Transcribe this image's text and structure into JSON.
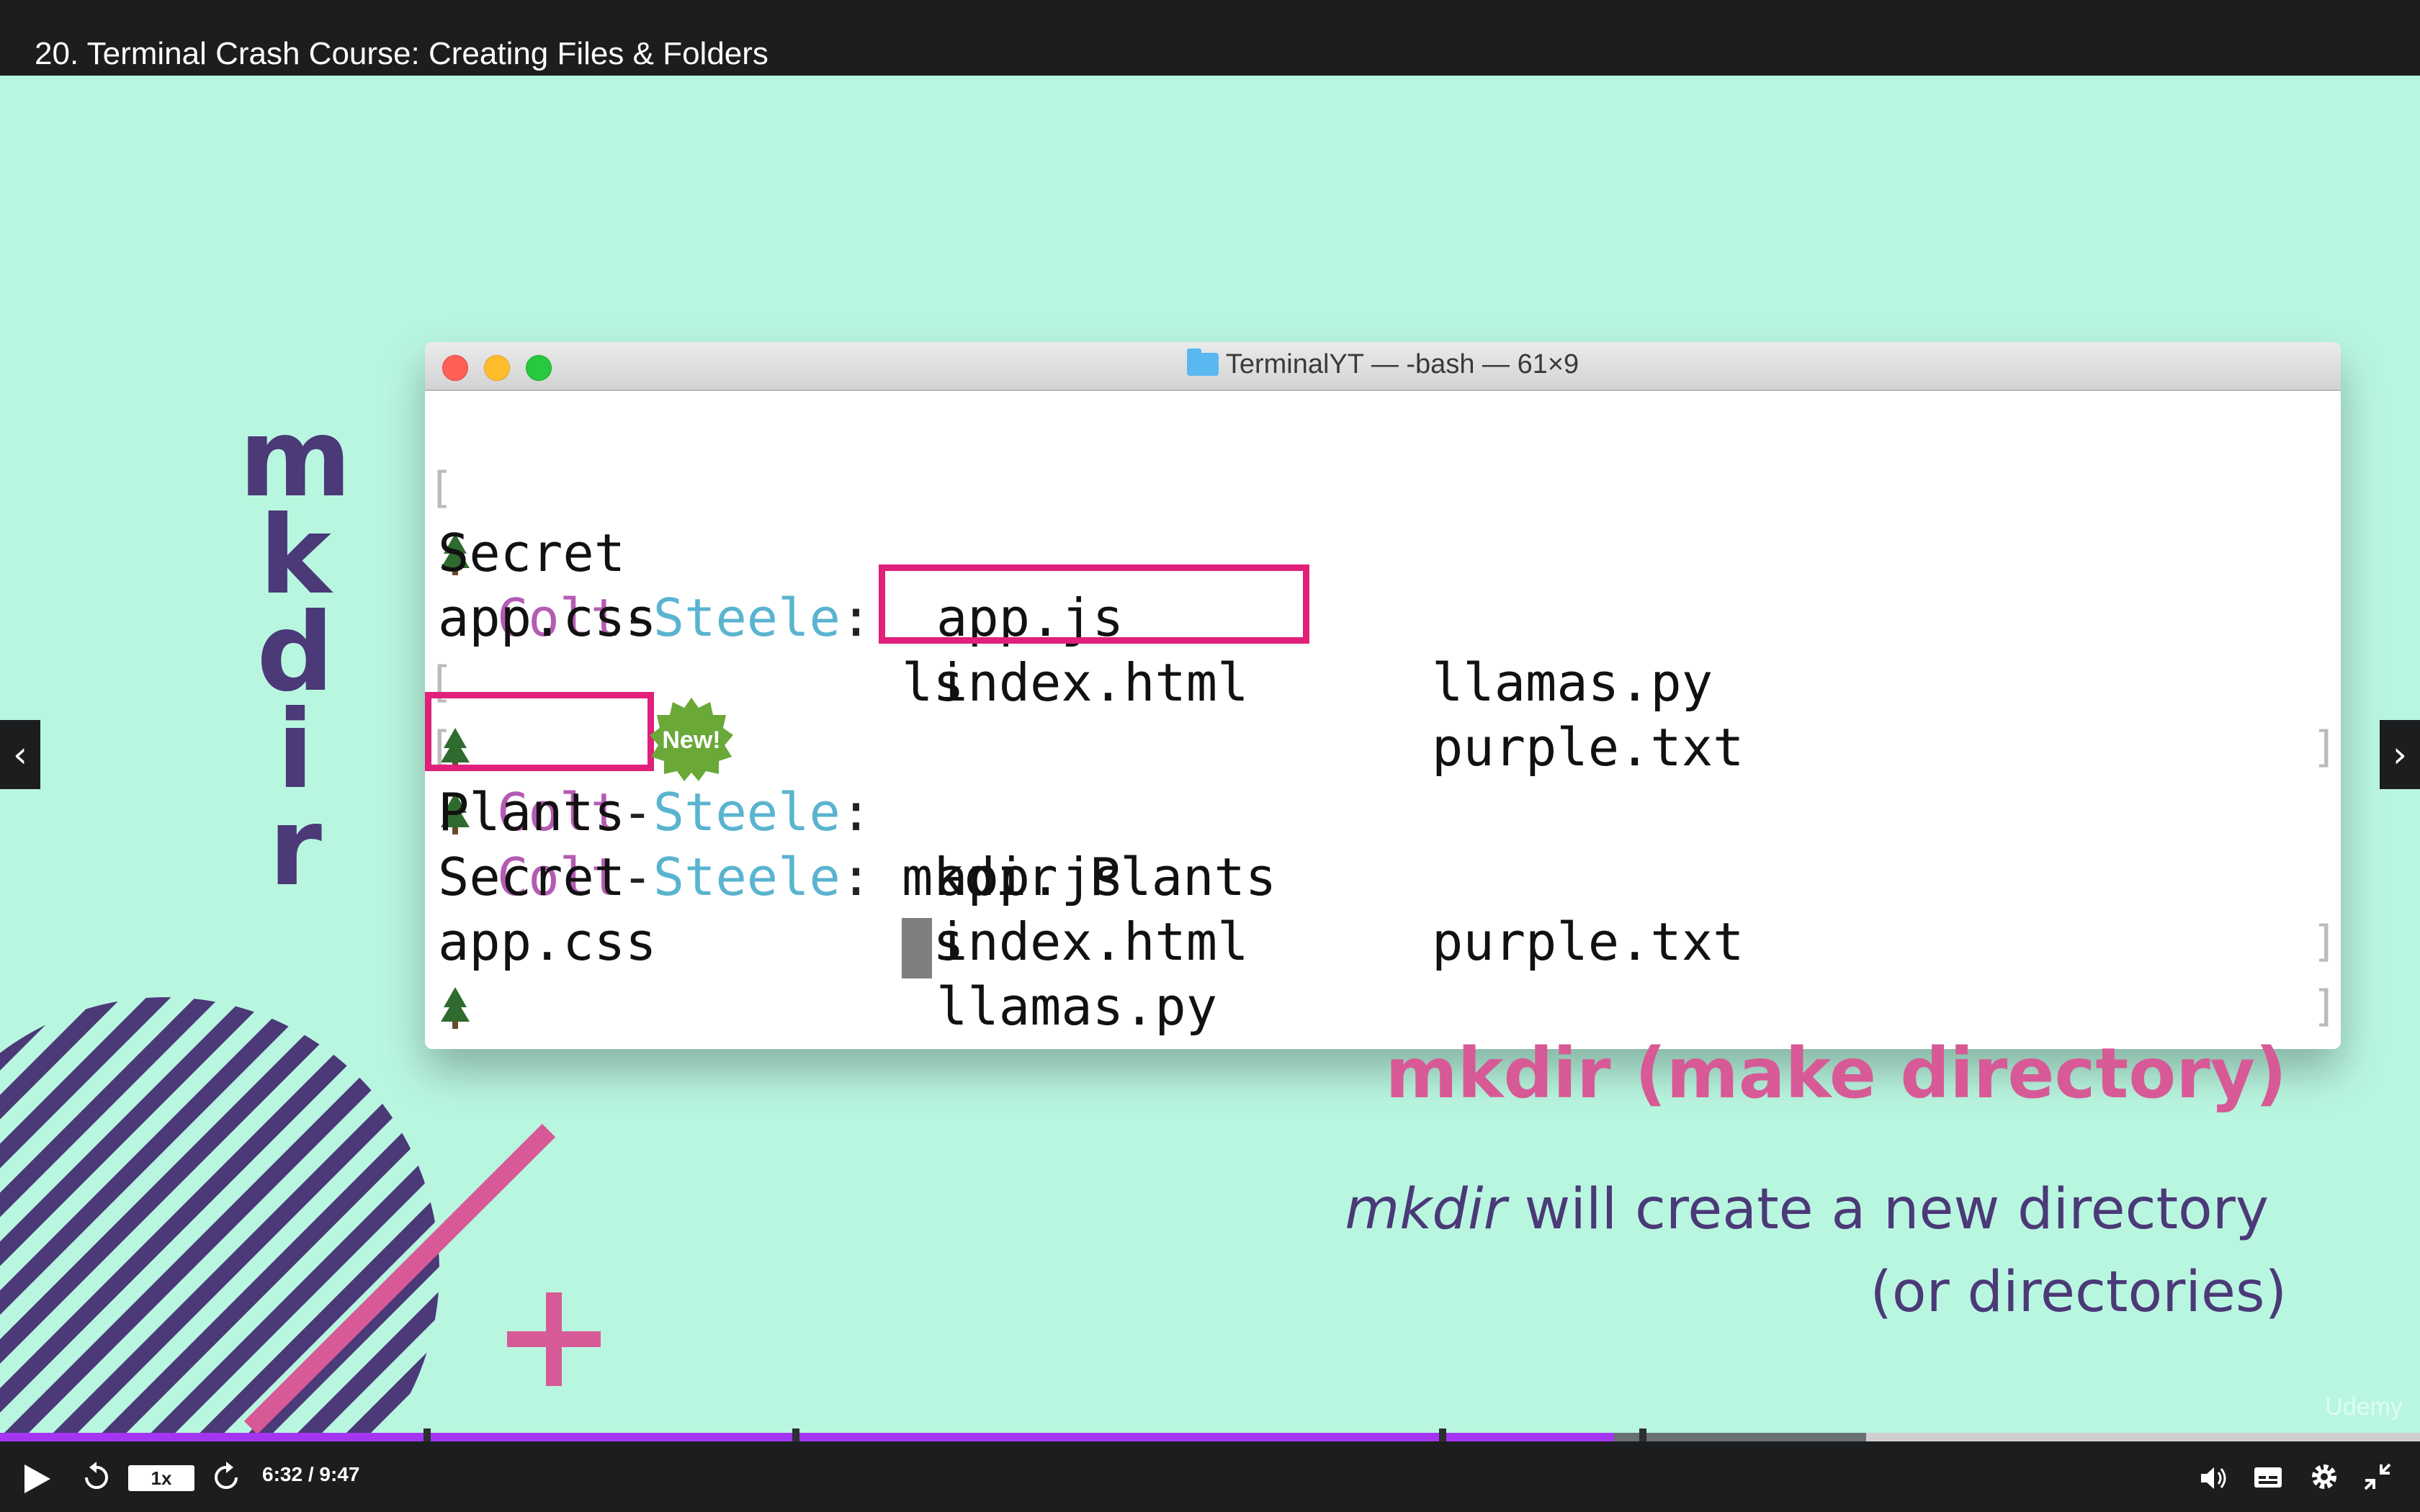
{
  "lecture": {
    "title": "20. Terminal Crash Course: Creating Files & Folders"
  },
  "slide": {
    "vertical_word": [
      "m",
      "k",
      "d",
      "i",
      "r"
    ],
    "heading": "mkdir (make directory)",
    "description_em": "mkdir",
    "description_rest": " will create a new directory",
    "description_line2": "(or directories)",
    "watermark": "Udemy"
  },
  "terminal": {
    "title": "TerminalYT — -bash — 61×9",
    "prompt_user": "Colt",
    "prompt_dash": "-",
    "prompt_host": "Steele",
    "prompt_colon": ":",
    "lines": {
      "cmd1": "ls",
      "row1": [
        "Secret",
        "app.js",
        "llamas.py"
      ],
      "row2": [
        "app.css",
        "index.html",
        "purple.txt"
      ],
      "cmd2": "mkdir Plants",
      "cmd3": "ls",
      "row3": [
        "Plants",
        "app.js",
        "purple.txt"
      ],
      "row4": [
        "Secret",
        "index.html",
        ""
      ],
      "row5": [
        "app.css",
        "llamas.py",
        ""
      ]
    },
    "badge": "New!"
  },
  "player": {
    "speed": "1x",
    "time": "6:32 / 9:47",
    "progress_fraction": 0.667,
    "buffered_fraction": 0.771
  },
  "colors": {
    "slide_bg": "#b9f6e0",
    "accent_purple": "#4b3978",
    "accent_pink": "#d75a96",
    "highlight": "#e0207a",
    "progress": "#a435f0"
  }
}
